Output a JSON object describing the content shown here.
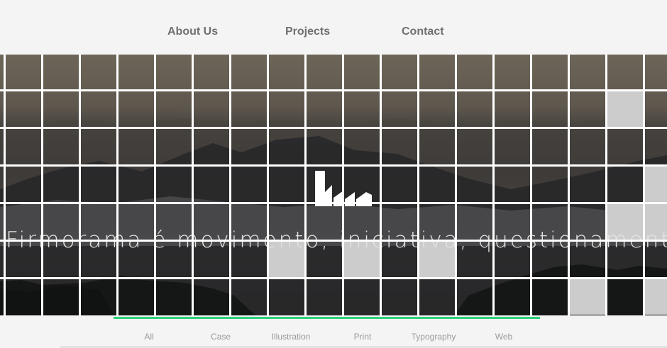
{
  "nav": {
    "about": "About Us",
    "projects": "Projects",
    "contact": "Contact"
  },
  "hero": {
    "tagline": "Firmorama é movimento, iniciativa, questionamento e mutação"
  },
  "filters": {
    "items": [
      "All",
      "Case",
      "Illustration",
      "Print",
      "Typography",
      "Web"
    ]
  },
  "colors": {
    "accent": "#2fd27d",
    "nav_text": "#707070",
    "filter_text": "#9a9a9a",
    "grid_line": "#ffffff",
    "grey_tile": "#cccccc"
  }
}
